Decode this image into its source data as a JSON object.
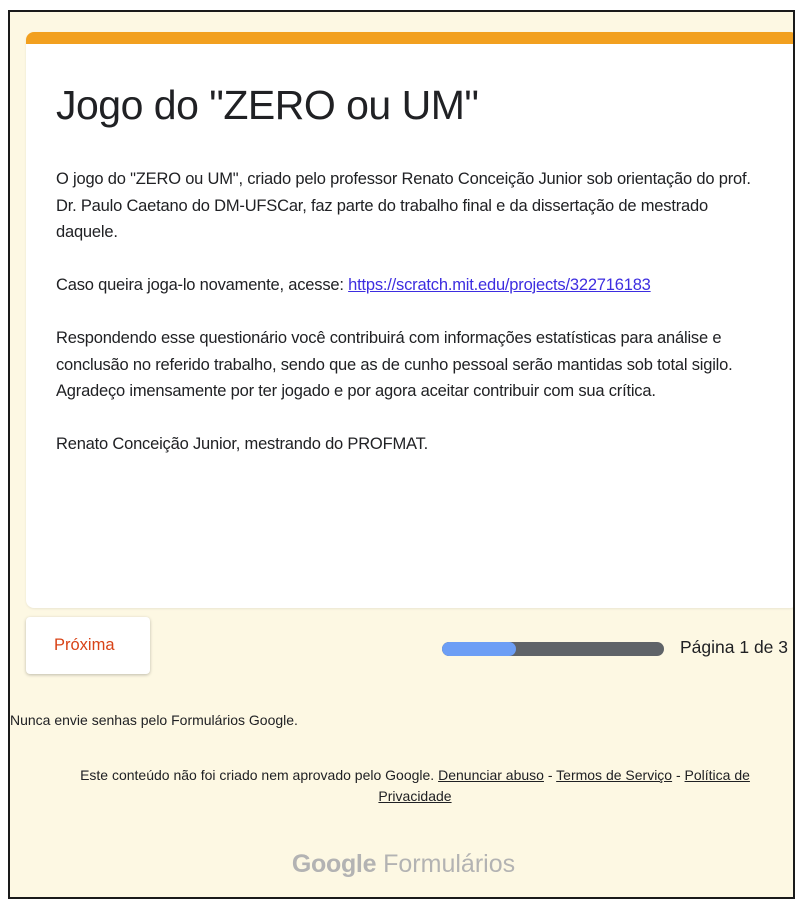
{
  "form": {
    "title": "Jogo do \"ZERO ou UM\"",
    "description": {
      "para1": "O jogo do \"ZERO ou UM\", criado pelo professor Renato Conceição Junior sob orientação do prof. Dr. Paulo Caetano do DM-UFSCar,  faz parte do trabalho final e da dissertação de mestrado daquele.",
      "para2_prefix": "Caso queira joga-lo novamente, acesse: ",
      "para2_link": "https://scratch.mit.edu/projects/322716183",
      "para3": "Respondendo esse questionário você contribuirá com informações estatísticas para análise e conclusão no referido trabalho, sendo que as de cunho pessoal serão mantidas sob total sigilo.",
      "para4": "Agradeço imensamente por ter jogado e por agora aceitar contribuir com sua crítica.",
      "para5": "Renato Conceição Junior, mestrando do PROFMAT."
    },
    "accent_color": "#f2a01f"
  },
  "navigation": {
    "next_label": "Próxima",
    "progress_fraction": 0.333,
    "page_label": "Página 1 de 3"
  },
  "footer": {
    "password_warning": "Nunca envie senhas pelo Formulários Google.",
    "disclaimer_prefix": "Este conteúdo não foi criado nem aprovado pelo Google. ",
    "report_abuse": "Denunciar abuso",
    "separator1": " - ",
    "terms": "Termos de Serviço",
    "separator2": " - ",
    "privacy": "Política de Privacidade",
    "logo_google": "Google",
    "logo_forms": " Formulários"
  }
}
